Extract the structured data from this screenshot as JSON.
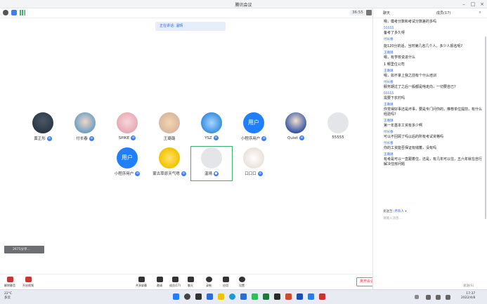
{
  "window": {
    "title": "腾讯会议"
  },
  "topbar": {
    "timer": "36:55"
  },
  "speaking": "正在讲话: 温晴",
  "participants": [
    {
      "name": "黄正彤"
    },
    {
      "name": "付长春"
    },
    {
      "name": "SPIKE"
    },
    {
      "name": "王璐璐"
    },
    {
      "name": "YSZ"
    },
    {
      "name": "小程序用户",
      "avatar_text": "用户"
    },
    {
      "name": "Quiet"
    },
    {
      "name": "55555"
    },
    {
      "name": "小程序用户",
      "avatar_text": "用户"
    },
    {
      "name": "蒙古草原天气嗯"
    },
    {
      "name": "温晴"
    },
    {
      "name": "口口口"
    }
  ],
  "shared_label": "2675分享...",
  "toolbar": {
    "items": [
      {
        "label": "解除静音"
      },
      {
        "label": "开启视频"
      },
      {
        "label": "共享屏幕"
      },
      {
        "label": "邀请"
      },
      {
        "label": "成员(17)"
      },
      {
        "label": "聊天"
      },
      {
        "label": "录制"
      },
      {
        "label": "应用"
      },
      {
        "label": "设置"
      }
    ],
    "leave_label": "离开会议"
  },
  "chat": {
    "tab_chat": "聊天",
    "tab_members": "成员(17)",
    "messages": [
      {
        "who": "",
        "text": "嗯，模考分数和考试分数差的多吗"
      },
      {
        "who": "55555",
        "text": "备考了多久呀"
      },
      {
        "who": "付长春",
        "text": ""
      },
      {
        "who": "",
        "text": "能120分的话，当时第几名几个人，多少人报名呢?"
      },
      {
        "who": "王璐璐",
        "text": "嗯，有学校说进什么"
      },
      {
        "who": "",
        "text": "1 哪里位公司"
      },
      {
        "who": "王璐璐",
        "text": "嗯，如不掌上我之前有个什么培训"
      },
      {
        "who": "付长春",
        "text": "服务期过了之后一般都是啥走向，一切要自己?"
      },
      {
        "who": "55555",
        "text": "需要下农村吗"
      },
      {
        "who": "王璐璐",
        "text": "你觉得好事还是坏事，要是专门问你的，推荐单位提前，有什么经验吗?"
      },
      {
        "who": "王璐璐",
        "text": "第一年基本工资有多少啊"
      },
      {
        "who": "付长春",
        "text": "可以不回顾了吗以后的所有考试资格吗"
      },
      {
        "who": "付长春",
        "text": "你的工资能否保证有储蓄，没有吗"
      },
      {
        "who": "王璐璐",
        "text": "有考是可以一直跟着住，还是，有几年可以住，五六年就在自行解决住房问题"
      }
    ],
    "send_to_label": "发送至:",
    "send_to_value": "所有人",
    "input_placeholder": "请输入消息...",
    "send_button": "发送(S)"
  },
  "taskbar": {
    "weather_temp": "22°C",
    "weather_desc": "多云",
    "time": "17:37",
    "date": "2022/4/8"
  }
}
